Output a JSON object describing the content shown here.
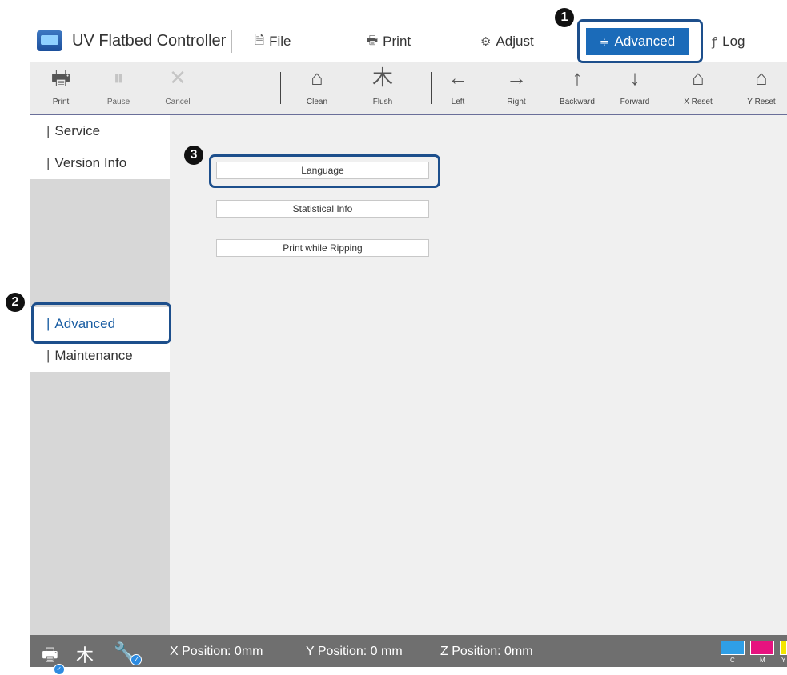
{
  "app": {
    "title": "UV Flatbed Controller"
  },
  "menu": [
    {
      "label": "File",
      "icon": "file-icon",
      "glyph": "🗎"
    },
    {
      "label": "Print",
      "icon": "print-icon",
      "glyph": "🖶"
    },
    {
      "label": "Adjust",
      "icon": "gear-icon",
      "glyph": "⚙"
    },
    {
      "label": "Advanced",
      "icon": "sliders-icon",
      "glyph": "≑",
      "active": true
    },
    {
      "label": "Log",
      "icon": "key-icon",
      "glyph": "ꝭ"
    }
  ],
  "toolbar": [
    {
      "label": "Print",
      "icon": "printer-icon",
      "glyph": "🖶",
      "enabled": true
    },
    {
      "label": "Pause",
      "icon": "pause-icon",
      "glyph": "⏸",
      "enabled": false
    },
    {
      "label": "Cancel",
      "icon": "cancel-x-icon",
      "glyph": "✕",
      "enabled": false
    },
    {
      "label": "Clean",
      "icon": "clean-icon",
      "glyph": "⌂",
      "enabled": true
    },
    {
      "label": "Flush",
      "icon": "flush-icon",
      "glyph": "⽊",
      "enabled": true
    },
    {
      "label": "Left",
      "icon": "arrow-left-icon",
      "glyph": "←",
      "enabled": true
    },
    {
      "label": "Right",
      "icon": "arrow-right-icon",
      "glyph": "→",
      "enabled": true
    },
    {
      "label": "Backward",
      "icon": "arrow-up-icon",
      "glyph": "↑",
      "enabled": true
    },
    {
      "label": "Forward",
      "icon": "arrow-down-icon",
      "glyph": "↓",
      "enabled": true
    },
    {
      "label": "X Reset",
      "icon": "home-x-icon",
      "glyph": "⌂",
      "enabled": true
    },
    {
      "label": "Y Reset",
      "icon": "home-y-icon",
      "glyph": "⌂",
      "enabled": true
    }
  ],
  "sidebar": {
    "items": [
      {
        "label": "Service"
      },
      {
        "label": "Version Info"
      },
      {
        "label": "Advanced",
        "active": true
      },
      {
        "label": "Maintenance"
      }
    ]
  },
  "content": {
    "buttons": [
      {
        "label": "Language"
      },
      {
        "label": "Statistical Info"
      },
      {
        "label": "Print while Ripping"
      }
    ]
  },
  "status": {
    "x_position": "X Position: 0mm",
    "y_position": "Y Position: 0 mm",
    "z_position": "Z Position: 0mm",
    "inks": [
      {
        "label": "C",
        "color": "#2f9fe6"
      },
      {
        "label": "M",
        "color": "#e6137f"
      },
      {
        "label": "Y",
        "color": "#f3e600"
      }
    ]
  },
  "callouts": [
    "1",
    "2",
    "3"
  ],
  "colors": {
    "accent": "#1b6bb9",
    "callout": "#1d4f8c"
  }
}
